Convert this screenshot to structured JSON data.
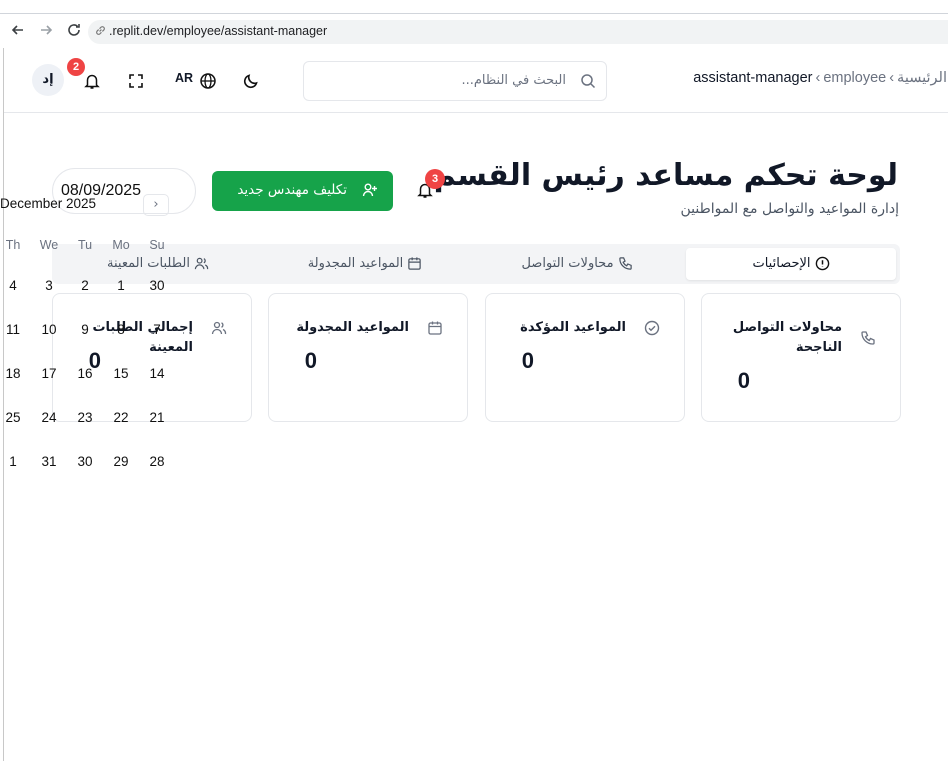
{
  "browser": {
    "url": ".replit.dev/employee/assistant-manager"
  },
  "header": {
    "breadcrumb": [
      "الرئيسية",
      "employee",
      "assistant-manager"
    ],
    "search_placeholder": "البحث في النظام...",
    "language": "AR",
    "notification_count": "2",
    "avatar_initials": "إد"
  },
  "page": {
    "title": "لوحة تحكم مساعد رئيس القسم",
    "subtitle": "إدارة المواعيد والتواصل مع المواطنين",
    "alerts_count": "3",
    "assign_button": "تكليف مهندس جديد",
    "date_value": "08/09/2025"
  },
  "tabs": [
    {
      "label": "الإحصائيات",
      "active": true
    },
    {
      "label": "محاولات التواصل",
      "active": false
    },
    {
      "label": "المواعيد المجدولة",
      "active": false
    },
    {
      "label": "الطلبات المعينة",
      "active": false
    }
  ],
  "cards": [
    {
      "title": "محاولات التواصل الناجحة",
      "value": "0"
    },
    {
      "title": "المواعيد المؤكدة",
      "value": "0"
    },
    {
      "title": "المواعيد المجدولة",
      "value": "0"
    },
    {
      "title": "إجمالي الطلبات المعينة",
      "value": "0"
    }
  ],
  "calendar": {
    "month_label": "December 2025",
    "weekdays": [
      "Th",
      "We",
      "Tu",
      "Mo",
      "Su"
    ],
    "weeks": [
      [
        "4",
        "3",
        "2",
        "1",
        "30"
      ],
      [
        "11",
        "10",
        "9",
        "8",
        "7"
      ],
      [
        "18",
        "17",
        "16",
        "15",
        "14"
      ],
      [
        "25",
        "24",
        "23",
        "22",
        "21"
      ],
      [
        "1",
        "31",
        "30",
        "29",
        "28"
      ]
    ]
  },
  "colors": {
    "primary_green": "#16a34a",
    "badge_red": "#ef4444"
  }
}
